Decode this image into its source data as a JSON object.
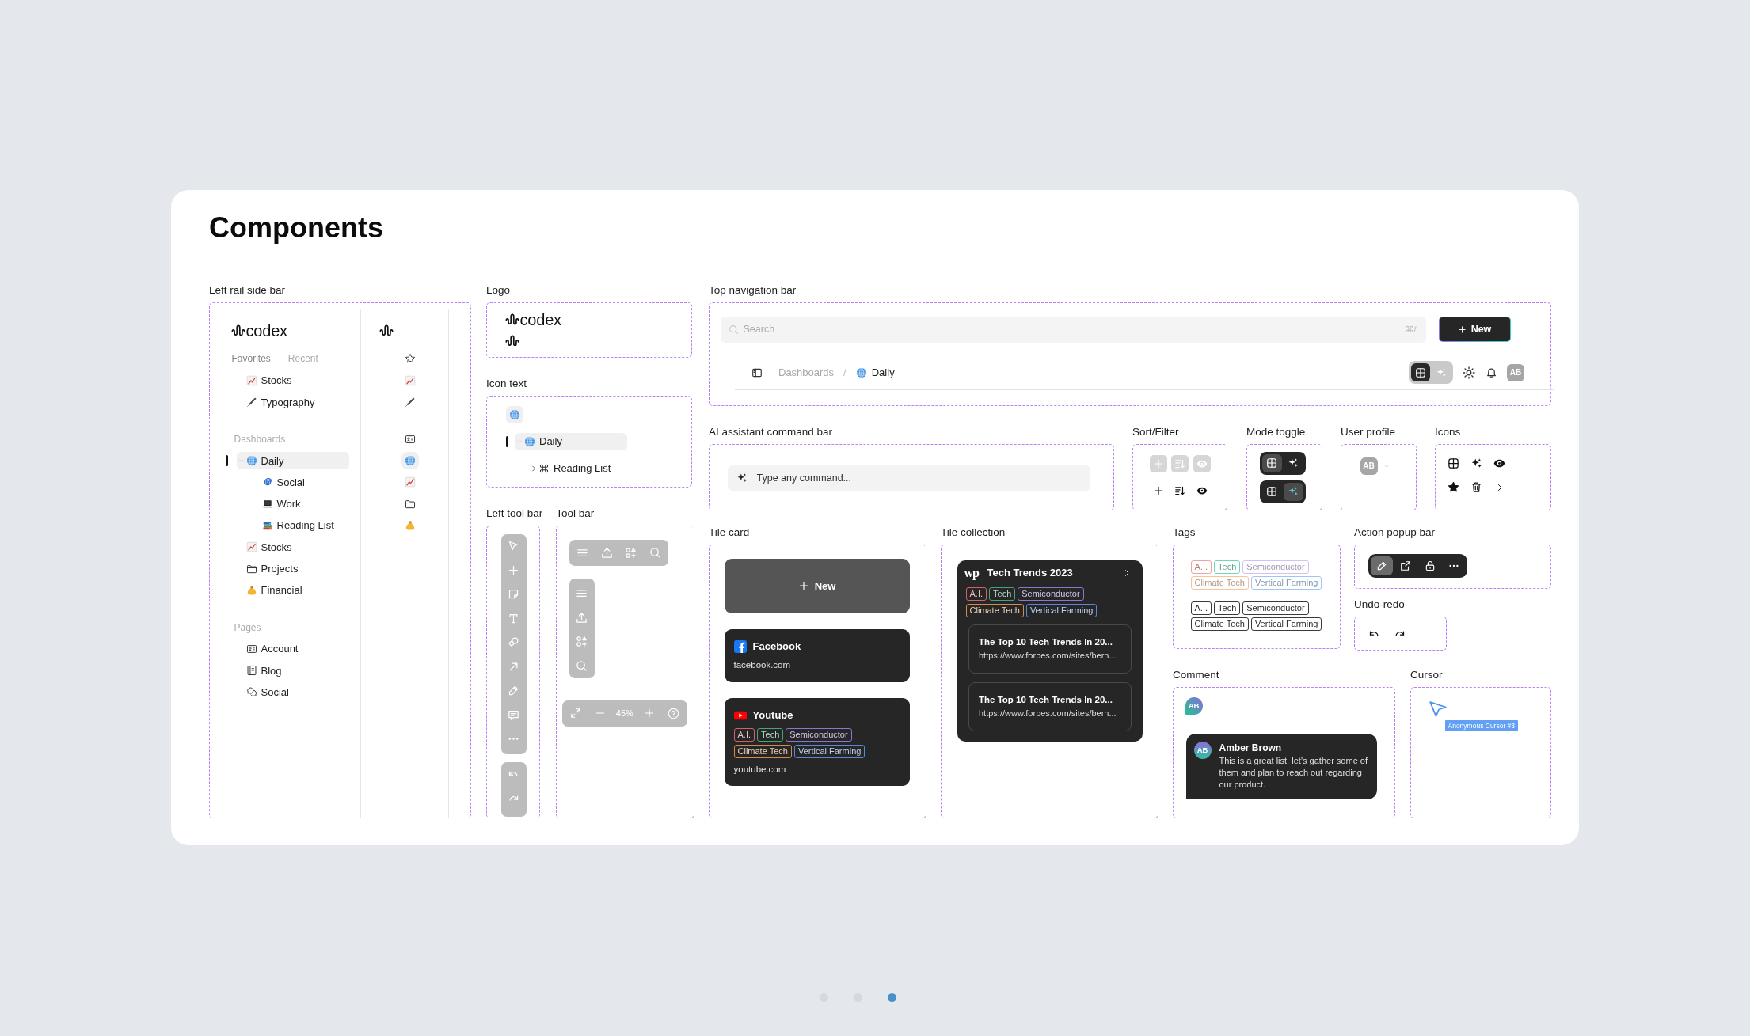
{
  "title": "Components",
  "left_rail_side_bar": {
    "label": "Left rail side bar",
    "logo_text": "codex",
    "tabs": [
      {
        "label": "Favorites",
        "selected": true
      },
      {
        "label": "Recent",
        "selected": false
      }
    ],
    "groups": [
      {
        "items": [
          {
            "label": "Stocks",
            "kind": "chart",
            "selected": false
          },
          {
            "label": "Typography",
            "kind": "pen",
            "selected": false
          }
        ]
      },
      {
        "heading": "Dashboards",
        "items": [
          {
            "label": "Daily",
            "kind": "globe",
            "selected": true,
            "expanded": true,
            "children": [
              {
                "label": "Social",
                "kind": "spiral",
                "selected": false
              },
              {
                "label": "Work",
                "kind": "laptop",
                "selected": false
              },
              {
                "label": "Reading List",
                "kind": "books",
                "selected": false
              }
            ]
          },
          {
            "label": "Stocks",
            "kind": "chart",
            "selected": false
          },
          {
            "label": "Projects",
            "kind": "folder",
            "selected": false
          },
          {
            "label": "Financial",
            "kind": "moneybag",
            "selected": false
          }
        ]
      },
      {
        "heading": "Pages",
        "items": [
          {
            "label": "Account",
            "kind": "card",
            "selected": false
          },
          {
            "label": "Blog",
            "kind": "document",
            "selected": false
          },
          {
            "label": "Social",
            "kind": "chat",
            "selected": false
          }
        ]
      }
    ],
    "rail": [
      {
        "items": [
          {
            "kind": "star",
            "selected": false
          },
          {
            "kind": "chart",
            "selected": false
          },
          {
            "kind": "pen",
            "selected": false
          }
        ]
      },
      {
        "items": [
          {
            "kind": "card",
            "selected": false
          },
          {
            "kind": "globe",
            "selected": true
          },
          {
            "kind": "chart",
            "selected": false
          },
          {
            "kind": "folder",
            "selected": false
          },
          {
            "kind": "moneybag",
            "selected": false
          }
        ]
      }
    ]
  },
  "logo": {
    "label": "Logo",
    "variants": [
      {
        "kind": "full",
        "text": "codex"
      },
      {
        "kind": "mark"
      }
    ]
  },
  "icon_text": {
    "label": "Icon text",
    "icon_only": {
      "kind": "globe",
      "selected": true
    },
    "items": [
      {
        "label": "Daily",
        "kind": "globe",
        "selected": true,
        "expanded": true,
        "children": [
          {
            "label": "Reading List",
            "kind": "command",
            "selected": false,
            "expanded": false
          }
        ]
      }
    ]
  },
  "left_tool_bar": {
    "label": "Left tool bar",
    "tools": [
      {
        "kind": "select"
      },
      {
        "kind": "add"
      },
      {
        "kind": "note"
      },
      {
        "kind": "text"
      },
      {
        "kind": "shapes"
      },
      {
        "kind": "arrow"
      },
      {
        "kind": "pencil"
      },
      {
        "kind": "comment"
      },
      {
        "kind": "more"
      }
    ],
    "history": [
      {
        "kind": "undo"
      },
      {
        "kind": "redo"
      }
    ]
  },
  "tool_bar": {
    "label": "Tool bar",
    "horizontal": [
      {
        "kind": "menu"
      },
      {
        "kind": "upload"
      },
      {
        "kind": "apps"
      },
      {
        "kind": "search"
      }
    ],
    "vertical": [
      {
        "kind": "menu"
      },
      {
        "kind": "upload"
      },
      {
        "kind": "apps"
      },
      {
        "kind": "search"
      }
    ],
    "zoom": {
      "reading": "45%"
    }
  },
  "top_navigation_bar": {
    "label": "Top navigation bar",
    "search": {
      "placeholder": "Search",
      "shortcut": "⌘/"
    },
    "new_button": {
      "label": "New"
    },
    "breadcrumb": [
      {
        "label": "Dashboards",
        "kind": "plain",
        "current": false
      },
      {
        "label": "Daily",
        "kind": "globe",
        "current": true
      }
    ],
    "separator": "/",
    "mode_toggle": [
      {
        "kind": "grid",
        "selected": true
      },
      {
        "kind": "ai",
        "selected": false
      }
    ],
    "avatar": {
      "initials": "AB"
    }
  },
  "ai_assistant_command_bar": {
    "label": "AI assistant command bar",
    "placeholder": "Type any command..."
  },
  "sort_filter": {
    "label": "Sort/Filter",
    "rows": [
      {
        "disabled": true,
        "buttons": [
          {
            "kind": "add"
          },
          {
            "kind": "sort"
          },
          {
            "kind": "view"
          }
        ]
      },
      {
        "disabled": false,
        "buttons": [
          {
            "kind": "add"
          },
          {
            "kind": "sort"
          },
          {
            "kind": "view"
          }
        ]
      }
    ]
  },
  "mode_toggle": {
    "label": "Mode toggle",
    "toggles": [
      {
        "options": [
          {
            "kind": "grid",
            "selected": true
          },
          {
            "kind": "ai",
            "selected": false
          }
        ]
      },
      {
        "options": [
          {
            "kind": "grid",
            "selected": false
          },
          {
            "kind": "ai",
            "selected": true
          }
        ]
      }
    ]
  },
  "user_profile": {
    "label": "User profile",
    "initials": "AB"
  },
  "icons": {
    "label": "Icons",
    "icons": [
      {
        "kind": "grid"
      },
      {
        "kind": "ai"
      },
      {
        "kind": "view"
      },
      {
        "kind": "star"
      },
      {
        "kind": "delete"
      },
      {
        "kind": "next"
      }
    ]
  },
  "tile_card": {
    "label": "Tile card",
    "new_tile": {
      "label": "New"
    },
    "tiles": [
      {
        "kind": "facebook",
        "title": "Facebook",
        "url": "facebook.com"
      },
      {
        "kind": "youtube",
        "title": "Youtube",
        "tags": [
          {
            "label": "A.I.",
            "color": "#d2606a"
          },
          {
            "label": "Tech",
            "color": "#3ea57c"
          },
          {
            "label": "Semiconductor",
            "color": "#9272d0"
          },
          {
            "label": "Climate Tech",
            "color": "#cf8b50"
          },
          {
            "label": "Vertical Farming",
            "color": "#5a88d4"
          }
        ],
        "url": "youtube.com"
      }
    ]
  },
  "tile_collection": {
    "label": "Tile collection",
    "logo_text": "wp",
    "title": "Tech Trends 2023",
    "tags": [
      {
        "label": "A.I.",
        "color": "#d2606a"
      },
      {
        "label": "Tech",
        "color": "#3ea57c"
      },
      {
        "label": "Semiconductor",
        "color": "#9272d0"
      },
      {
        "label": "Climate Tech",
        "color": "#cf8b50"
      },
      {
        "label": "Vertical Farming",
        "color": "#5a88d4"
      }
    ],
    "links": [
      {
        "title": "The Top 10 Tech Trends In 20...",
        "url": "https://www.forbes.com/sites/bern..."
      },
      {
        "title": "The Top 10 Tech Trends In 20...",
        "url": "https://www.forbes.com/sites/bern..."
      }
    ]
  },
  "tags": {
    "label": "Tags",
    "sets": [
      {
        "disabled": true,
        "tags": [
          {
            "label": "A.I.",
            "color": "#f3a2a2"
          },
          {
            "label": "Tech",
            "color": "#6fd6b6"
          },
          {
            "label": "Semiconductor",
            "color": "#d4c0f5"
          },
          {
            "label": "Climate Tech",
            "color": "#f6c39b"
          },
          {
            "label": "Vertical Farming",
            "color": "#a2c4f3"
          }
        ]
      },
      {
        "disabled": false,
        "tags": [
          {
            "label": "A.I."
          },
          {
            "label": "Tech"
          },
          {
            "label": "Semiconductor"
          },
          {
            "label": "Climate Tech"
          },
          {
            "label": "Vertical Farming"
          }
        ]
      }
    ]
  },
  "action_popup_bar": {
    "label": "Action popup bar",
    "actions": [
      {
        "kind": "edit",
        "selected": true
      },
      {
        "kind": "open",
        "selected": false
      },
      {
        "kind": "lock",
        "selected": false
      },
      {
        "kind": "more",
        "selected": false
      }
    ]
  },
  "undo_redo": {
    "label": "Undo-redo",
    "actions": [
      {
        "kind": "undo"
      },
      {
        "kind": "redo"
      }
    ]
  },
  "comment": {
    "label": "Comment",
    "marker_initials": "AB",
    "author_initials": "AB",
    "author": "Amber Brown",
    "text": "This is a great list, let’s gather some of them and plan to reach out regarding our product."
  },
  "cursor": {
    "label": "Cursor",
    "name": "Anonymous Cursor #3"
  },
  "pagination": [
    {
      "selected": false
    },
    {
      "selected": false
    },
    {
      "selected": true
    }
  ]
}
